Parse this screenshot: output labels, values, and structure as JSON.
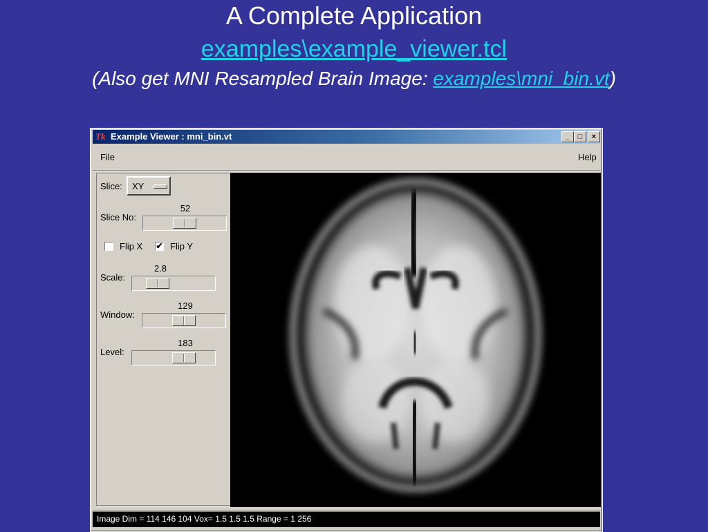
{
  "slide": {
    "title": "A Complete Application",
    "file_link": "examples\\example_viewer.tcl",
    "note_prefix": "(Also get MNI Resampled Brain Image: ",
    "note_link": "examples\\mni_bin.vt",
    "note_suffix": ")"
  },
  "window": {
    "title": "Example Viewer : mni_bin.vt",
    "buttons": [
      "_",
      "□",
      "×"
    ],
    "menu": {
      "file": "File",
      "help": "Help"
    },
    "controls": {
      "slice_label": "Slice:",
      "slice_value": "XY",
      "slice_no_label": "Slice No:",
      "slice_no_value": "52",
      "flip_x_label": "Flip X",
      "flip_x_checked": false,
      "flip_y_label": "Flip Y",
      "flip_y_checked": true,
      "scale_label": "Scale:",
      "scale_value": "2.8",
      "window_label": "Window:",
      "window_value": "129",
      "level_label": "Level:",
      "level_value": "183"
    },
    "status": "Image Dim = 114 146 104  Vox= 1.5 1.5 1.5  Range = 1 256"
  },
  "colors": {
    "background": "#333399",
    "link": "#1fd3e6",
    "titlebar_start": "#0a246a",
    "titlebar_end": "#a6caf0"
  }
}
